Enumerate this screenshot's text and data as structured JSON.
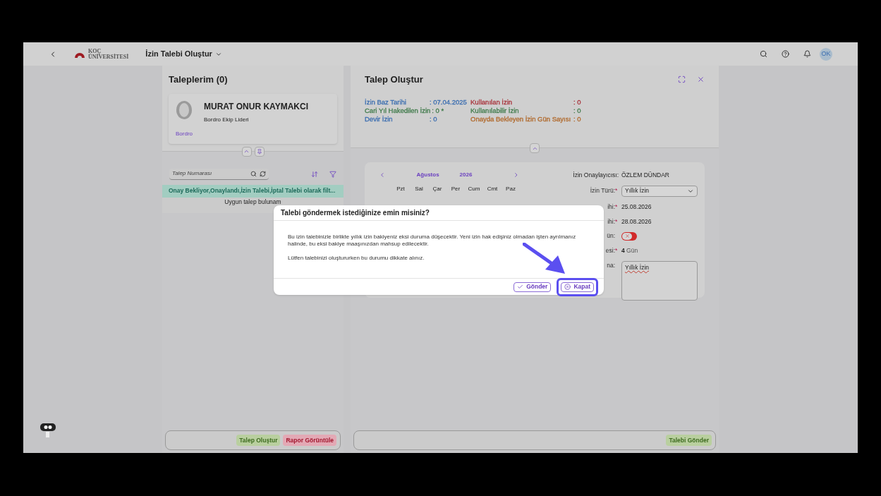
{
  "header": {
    "logo_lines": [
      "KOÇ",
      "ÜNİVERSİTESİ"
    ],
    "title": "İzin Talebi Oluştur",
    "avatar": "OK"
  },
  "left": {
    "title": "Taleplerim (0)",
    "profile": {
      "name": "MURAT ONUR KAYMAKCI",
      "role": "Bordro Ekip Lideri",
      "department": "Bordro"
    },
    "search": {
      "placeholder": "Talep Numarası"
    },
    "filter_banner": "Onay Bekliyor,Onaylandı,İzin Talebi,İptal Talebi olarak filt...",
    "empty_message": "Uygun talep bulunam",
    "buttons": [
      {
        "label": "Talep Oluştur",
        "kind": "success"
      },
      {
        "label": "Rapor Görüntüle",
        "kind": "danger"
      }
    ]
  },
  "right": {
    "title": "Talep Oluştur",
    "summary": [
      {
        "label": "İzin Baz Tarihi",
        "value": ": 07.04.2025",
        "color": "#3a6db0"
      },
      {
        "label": "Cari Yıl Hakedilen İzin",
        "value": ": 0 *",
        "color": "#3f7a4a"
      },
      {
        "label": "Devir İzin",
        "value": ": 0",
        "color": "#3a6db0"
      },
      {
        "label": "Kullanılan İzin",
        "value": ": 0",
        "color": "#a8323a"
      },
      {
        "label": "Kullanılabilir İzin",
        "value": ": 0",
        "color": "#3f7a4a"
      },
      {
        "label": "Onayda Bekleyen İzin Gün Sayısı",
        "value": ": 0",
        "color": "#b0682a"
      }
    ],
    "calendar": {
      "month": "Ağustos",
      "year": "2026",
      "weekdays": [
        "Pzt",
        "Sal",
        "Çar",
        "Per",
        "Cum",
        "Cmt",
        "Paz"
      ]
    },
    "approver": {
      "label": "İzin Onaylayıcısı:",
      "value": "ÖZLEM DÜNDAR"
    },
    "fields": [
      {
        "kind": "select",
        "label": "İzin Türü:",
        "required": true,
        "value": "Yıllık İzin"
      },
      {
        "kind": "text",
        "label": "ihi:",
        "required": true,
        "value": "25.08.2026"
      },
      {
        "kind": "text",
        "label": "ihi:",
        "required": true,
        "value": "28.08.2026"
      },
      {
        "kind": "toggle",
        "label": "ün:",
        "required": false,
        "on": false
      },
      {
        "kind": "duration",
        "label": "esi:",
        "required": true,
        "number": "4",
        "unit": "Gün"
      },
      {
        "kind": "textarea",
        "label": "na:",
        "required": false,
        "value": "Yıllık İzin"
      }
    ],
    "required_mark": "*",
    "footer_button": "Talebi Gönder"
  },
  "dialog": {
    "title": "Talebi göndermek istediğinize emin misiniz?",
    "paragraphs": [
      "Bu izin talebinizle birlikte yıllık izin bakiyeniz eksi duruma düşecektir. Yeni izin hak edişiniz olmadan işten ayrılmanız halinde, bu eksi bakiye maaşınızdan mahsup edilecektir.",
      "Lütfen talebinizi oluştururken bu durumu dikkate alınız."
    ],
    "buttons": [
      {
        "label": "Gönder",
        "kind": "send",
        "highlighted": false
      },
      {
        "label": "Kapat",
        "kind": "close",
        "highlighted": true
      }
    ]
  }
}
